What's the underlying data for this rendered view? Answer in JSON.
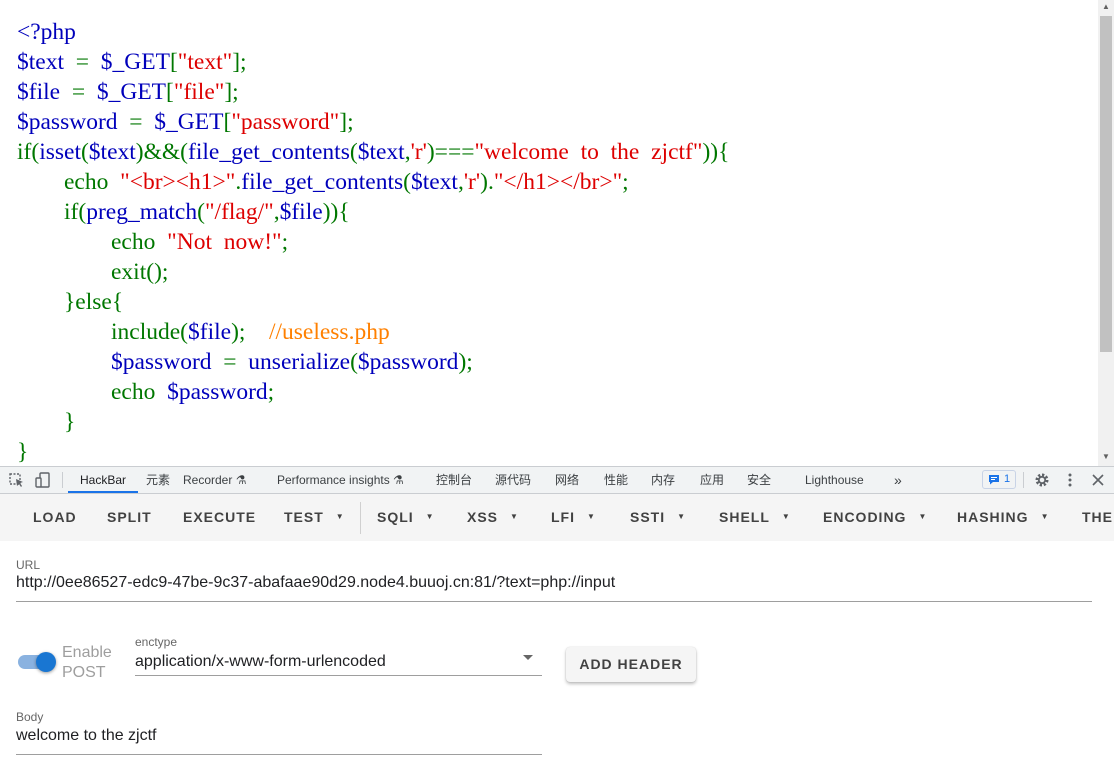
{
  "source": {
    "lines": [
      [
        [
          "v",
          "<?php"
        ]
      ],
      [
        [
          "v",
          "$text"
        ],
        [
          "k",
          "  =  "
        ],
        [
          "v",
          "$_GET"
        ],
        [
          "k",
          "["
        ],
        [
          "s",
          "\"text\""
        ],
        [
          "k",
          "];"
        ]
      ],
      [
        [
          "v",
          "$file"
        ],
        [
          "k",
          "  =  "
        ],
        [
          "v",
          "$_GET"
        ],
        [
          "k",
          "["
        ],
        [
          "s",
          "\"file\""
        ],
        [
          "k",
          "];"
        ]
      ],
      [
        [
          "v",
          "$password"
        ],
        [
          "k",
          "  =  "
        ],
        [
          "v",
          "$_GET"
        ],
        [
          "k",
          "["
        ],
        [
          "s",
          "\"password\""
        ],
        [
          "k",
          "];"
        ]
      ],
      [
        [
          "k",
          "if("
        ],
        [
          "v",
          "isset"
        ],
        [
          "k",
          "("
        ],
        [
          "v",
          "$text"
        ],
        [
          "k",
          ")&&("
        ],
        [
          "v",
          "file_get_contents"
        ],
        [
          "k",
          "("
        ],
        [
          "v",
          "$text"
        ],
        [
          "k",
          ","
        ],
        [
          "s",
          "'r'"
        ],
        [
          "k",
          ")==="
        ],
        [
          "s",
          "\"welcome  to  the  zjctf\""
        ],
        [
          "k",
          ")){"
        ]
      ],
      [
        [
          "k",
          "        echo  "
        ],
        [
          "s",
          "\"<br><h1>\""
        ],
        [
          "k",
          "."
        ],
        [
          "v",
          "file_get_contents"
        ],
        [
          "k",
          "("
        ],
        [
          "v",
          "$text"
        ],
        [
          "k",
          ","
        ],
        [
          "s",
          "'r'"
        ],
        [
          "k",
          ")."
        ],
        [
          "s",
          "\"</h1></br>\""
        ],
        [
          "k",
          ";"
        ]
      ],
      [
        [
          "k",
          "        if("
        ],
        [
          "v",
          "preg_match"
        ],
        [
          "k",
          "("
        ],
        [
          "s",
          "\"/flag/\""
        ],
        [
          "k",
          ","
        ],
        [
          "v",
          "$file"
        ],
        [
          "k",
          ")){"
        ]
      ],
      [
        [
          "k",
          "                echo  "
        ],
        [
          "s",
          "\"Not  now!\""
        ],
        [
          "k",
          ";"
        ]
      ],
      [
        [
          "k",
          "                exit();"
        ]
      ],
      [
        [
          "k",
          "        }else{"
        ]
      ],
      [
        [
          "k",
          "                include("
        ],
        [
          "v",
          "$file"
        ],
        [
          "k",
          ");    "
        ],
        [
          "c",
          "//useless.php"
        ]
      ],
      [
        [
          "k",
          "                "
        ],
        [
          "v",
          "$password"
        ],
        [
          "k",
          "  =  "
        ],
        [
          "v",
          "unserialize"
        ],
        [
          "k",
          "("
        ],
        [
          "v",
          "$password"
        ],
        [
          "k",
          ");"
        ]
      ],
      [
        [
          "k",
          "                echo  "
        ],
        [
          "v",
          "$password"
        ],
        [
          "k",
          ";"
        ]
      ],
      [
        [
          "k",
          "        }"
        ]
      ],
      [
        [
          "k",
          "}"
        ]
      ]
    ]
  },
  "devtools": {
    "tabs": [
      {
        "label": "HackBar",
        "active": true
      },
      {
        "label": "元素"
      },
      {
        "label": "Recorder ⚗"
      },
      {
        "label": "Performance insights ⚗"
      },
      {
        "label": "控制台"
      },
      {
        "label": "源代码"
      },
      {
        "label": "网络"
      },
      {
        "label": "性能"
      },
      {
        "label": "内存"
      },
      {
        "label": "应用"
      },
      {
        "label": "安全"
      },
      {
        "label": "Lighthouse"
      }
    ],
    "more": "»",
    "issues_count": "1",
    "icons": [
      "inspect-icon",
      "device-toggle-icon",
      "issues-icon",
      "gear-icon",
      "kebab-menu-icon",
      "close-icon"
    ]
  },
  "hackbar": {
    "buttons": [
      {
        "label": "LOAD",
        "dropdown": false
      },
      {
        "label": "SPLIT",
        "dropdown": false
      },
      {
        "label": "EXECUTE",
        "dropdown": false
      },
      {
        "label": "TEST",
        "dropdown": true
      },
      {
        "label": "SQLI",
        "dropdown": true
      },
      {
        "label": "XSS",
        "dropdown": true
      },
      {
        "label": "LFI",
        "dropdown": true
      },
      {
        "label": "SSTI",
        "dropdown": true
      },
      {
        "label": "SHELL",
        "dropdown": true
      },
      {
        "label": "ENCODING",
        "dropdown": true
      },
      {
        "label": "HASHING",
        "dropdown": true
      },
      {
        "label": "THE",
        "dropdown": false
      }
    ],
    "url_label": "URL",
    "url_value": "http://0ee86527-edc9-47be-9c37-abafaae90d29.node4.buuoj.cn:81/?text=php://input",
    "post_toggle_label": "Enable POST",
    "post_enabled": true,
    "enctype_label": "enctype",
    "enctype_value": "application/x-www-form-urlencoded",
    "add_header_label": "ADD HEADER",
    "body_label": "Body",
    "body_value": "welcome to the zjctf"
  },
  "colors": {
    "php_default": "#0000bb",
    "php_keyword": "#007700",
    "php_string": "#dd0000",
    "php_comment": "#ff8000",
    "accent": "#1a73e8",
    "toggle_on": "#1976d2"
  }
}
